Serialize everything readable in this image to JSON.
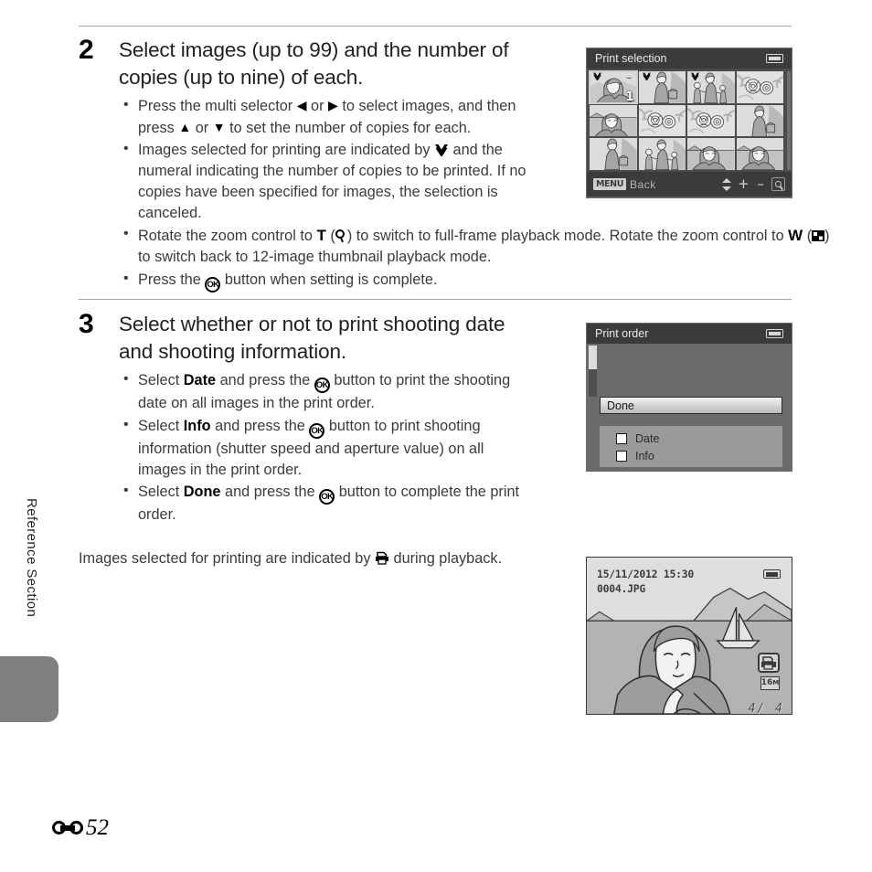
{
  "page": {
    "side_label": "Reference Section",
    "page_number": "52",
    "page_prefix_icon": "reference-section-icon"
  },
  "steps": [
    {
      "number": "2",
      "title": "Select images (up to 99) and the number of copies (up to nine) of each.",
      "bullets": [
        {
          "id": "multi-selector",
          "parts": [
            {
              "t": "text",
              "v": "Press the multi selector "
            },
            {
              "t": "icon",
              "v": "◀",
              "name": "left-arrow-icon"
            },
            {
              "t": "text",
              "v": " or "
            },
            {
              "t": "icon",
              "v": "▶",
              "name": "right-arrow-icon"
            },
            {
              "t": "text",
              "v": " to select images, and then press "
            },
            {
              "t": "icon",
              "v": "▲",
              "name": "up-arrow-icon"
            },
            {
              "t": "text",
              "v": " or "
            },
            {
              "t": "icon",
              "v": "▼",
              "name": "down-arrow-icon"
            },
            {
              "t": "text",
              "v": " to set the number of copies for each."
            }
          ]
        },
        {
          "id": "selection-indicator",
          "parts": [
            {
              "t": "text",
              "v": "Images selected for printing are indicated by "
            },
            {
              "t": "icon",
              "v": "check",
              "name": "check-mark-icon"
            },
            {
              "t": "text",
              "v": " and the numeral indicating the number of copies to be printed. If no copies have been specified for images, the selection is canceled."
            }
          ]
        },
        {
          "id": "zoom-control",
          "parts": [
            {
              "t": "text",
              "v": "Rotate the zoom control to "
            },
            {
              "t": "bold",
              "v": "T"
            },
            {
              "t": "text",
              "v": " ("
            },
            {
              "t": "icon",
              "v": "magnifier",
              "name": "magnifier-icon"
            },
            {
              "t": "text",
              "v": ") to switch to full-frame playback mode. Rotate the zoom control to "
            },
            {
              "t": "bold",
              "v": "W"
            },
            {
              "t": "text",
              "v": " ("
            },
            {
              "t": "icon",
              "v": "thumbnail",
              "name": "thumbnail-grid-icon"
            },
            {
              "t": "text",
              "v": ") to switch back to 12-image thumbnail playback mode."
            }
          ]
        },
        {
          "id": "ok-complete",
          "parts": [
            {
              "t": "text",
              "v": "Press the "
            },
            {
              "t": "icon",
              "v": "OK",
              "name": "ok-button-icon"
            },
            {
              "t": "text",
              "v": " button when setting is complete."
            }
          ]
        }
      ]
    },
    {
      "number": "3",
      "title": "Select whether or not to print shooting date and shooting information.",
      "bullets": [
        {
          "id": "select-date",
          "parts": [
            {
              "t": "text",
              "v": "Select "
            },
            {
              "t": "bold",
              "v": "Date"
            },
            {
              "t": "text",
              "v": " and press the "
            },
            {
              "t": "icon",
              "v": "OK",
              "name": "ok-button-icon"
            },
            {
              "t": "text",
              "v": " button to print the shooting date on all images in the print order."
            }
          ]
        },
        {
          "id": "select-info",
          "parts": [
            {
              "t": "text",
              "v": "Select "
            },
            {
              "t": "bold",
              "v": "Info"
            },
            {
              "t": "text",
              "v": " and press the "
            },
            {
              "t": "icon",
              "v": "OK",
              "name": "ok-button-icon"
            },
            {
              "t": "text",
              "v": " button to print shooting information (shutter speed and aperture value) on all images in the print order."
            }
          ]
        },
        {
          "id": "select-done",
          "parts": [
            {
              "t": "text",
              "v": "Select "
            },
            {
              "t": "bold",
              "v": "Done"
            },
            {
              "t": "text",
              "v": " and press the "
            },
            {
              "t": "icon",
              "v": "OK",
              "name": "ok-button-icon"
            },
            {
              "t": "text",
              "v": " button to complete the print order."
            }
          ]
        }
      ]
    }
  ],
  "tail_paragraph": {
    "parts": [
      {
        "t": "text",
        "v": "Images selected for printing are indicated by "
      },
      {
        "t": "icon",
        "v": "printer",
        "name": "print-order-icon"
      },
      {
        "t": "text",
        "v": " during playback."
      }
    ]
  },
  "screens": {
    "print_selection": {
      "title": "Print selection",
      "battery_icon": "battery-icon",
      "footer": {
        "menu_chip": "MENU",
        "back_label": "Back",
        "updown_icon": "up-down-arrows-icon",
        "plus": "+",
        "minus": "–",
        "magnifier_icon": "magnifier-icon"
      },
      "selected_index": 0,
      "thumbnails": [
        {
          "index": 1,
          "checked": true,
          "count": "1",
          "scene": "woman-portrait"
        },
        {
          "index": 2,
          "checked": true,
          "count": "",
          "scene": "woman-standing"
        },
        {
          "index": 3,
          "checked": true,
          "count": "",
          "scene": "family-group"
        },
        {
          "index": 4,
          "checked": false,
          "count": "",
          "scene": "flowers"
        },
        {
          "index": 5,
          "checked": false,
          "count": "",
          "scene": "woman-beach"
        },
        {
          "index": 6,
          "checked": false,
          "count": "",
          "scene": "flowers"
        },
        {
          "index": 7,
          "checked": false,
          "count": "",
          "scene": "flowers"
        },
        {
          "index": 8,
          "checked": false,
          "count": "",
          "scene": "woman-standing"
        },
        {
          "index": 9,
          "checked": false,
          "count": "",
          "scene": "woman-standing"
        },
        {
          "index": 10,
          "checked": false,
          "count": "",
          "scene": "family-group"
        },
        {
          "index": 11,
          "checked": false,
          "count": "",
          "scene": "woman-beach"
        },
        {
          "index": 12,
          "checked": false,
          "count": "",
          "scene": "woman-beach"
        }
      ]
    },
    "print_order": {
      "title": "Print order",
      "battery_icon": "battery-icon",
      "done_label": "Done",
      "options": [
        {
          "label": "Date",
          "checked": false
        },
        {
          "label": "Info",
          "checked": false
        }
      ]
    },
    "playback": {
      "date": "15/11/2012  15:30",
      "filename": "0004.JPG",
      "battery_icon": "battery-icon",
      "print_order_icon": "print-order-icon",
      "image_size": "16",
      "image_size_suffix": "M",
      "counter": "4/  4"
    }
  }
}
